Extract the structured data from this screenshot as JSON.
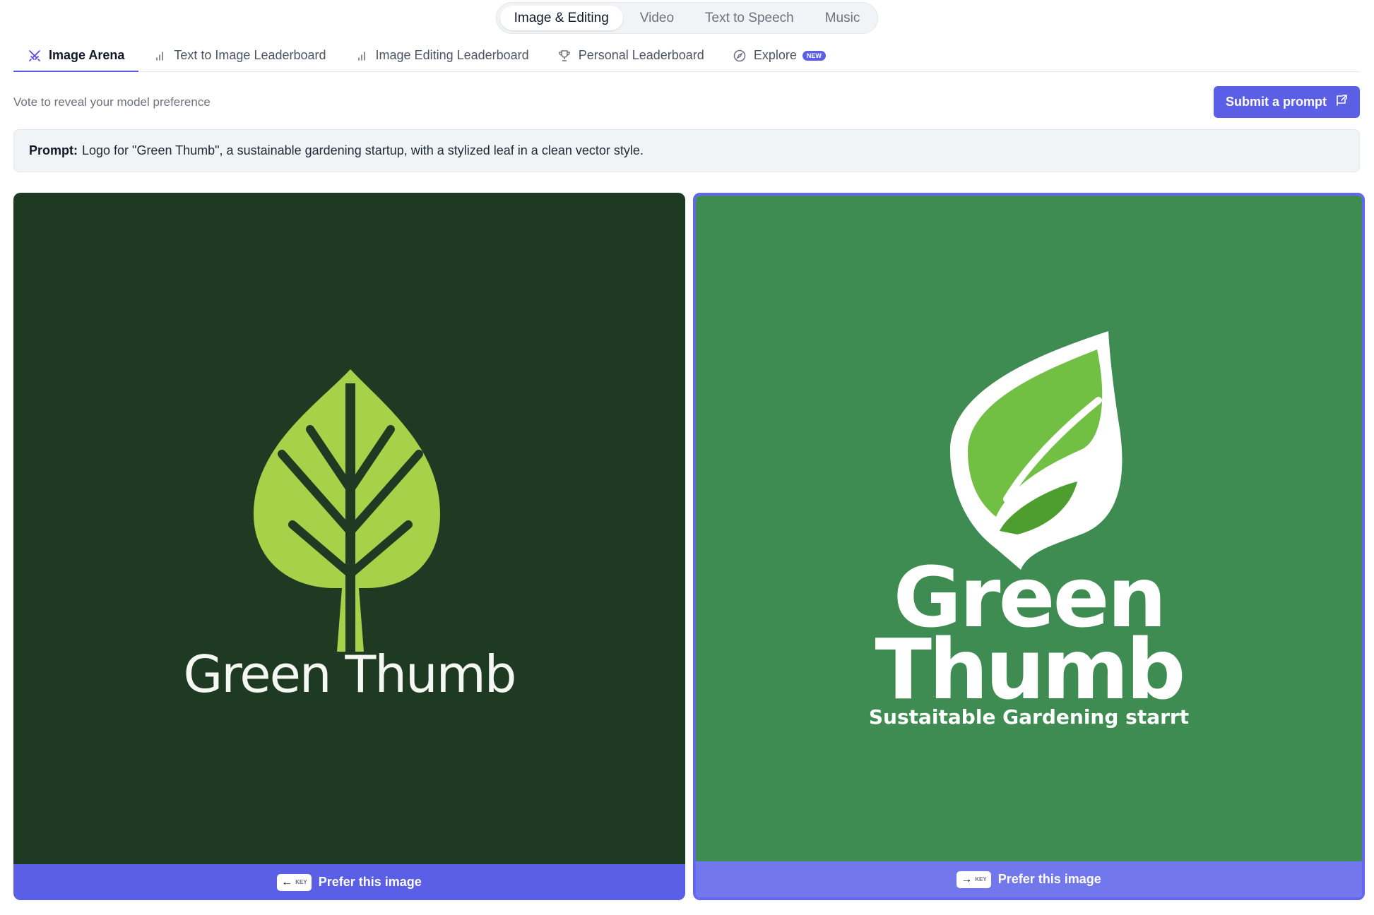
{
  "top_nav": {
    "items": [
      {
        "label": "Image & Editing",
        "active": true
      },
      {
        "label": "Video",
        "active": false
      },
      {
        "label": "Text to Speech",
        "active": false
      },
      {
        "label": "Music",
        "active": false
      }
    ]
  },
  "tabs": [
    {
      "label": "Image Arena",
      "icon": "arena-icon",
      "active": true
    },
    {
      "label": "Text to Image Leaderboard",
      "icon": "bar-chart-icon",
      "active": false
    },
    {
      "label": "Image Editing Leaderboard",
      "icon": "bar-chart-icon",
      "active": false
    },
    {
      "label": "Personal Leaderboard",
      "icon": "trophy-icon",
      "active": false
    },
    {
      "label": "Explore",
      "icon": "compass-icon",
      "active": false,
      "badge": "NEW"
    }
  ],
  "subtitle": "Vote to reveal your model preference",
  "submit_button": {
    "label": "Submit a prompt",
    "icon": "external-share-icon"
  },
  "prompt": {
    "label": "Prompt:",
    "text": "Logo for \"Green Thumb\", a sustainable gardening startup, with a stylized leaf in a clean vector style."
  },
  "cards": {
    "left": {
      "image_text": "Green Thumb",
      "prefer_label": "Prefer this image",
      "key_label": "KEY",
      "key_icon": "arrow-left-icon"
    },
    "right": {
      "image_text_line1": "Green",
      "image_text_line2": "Thumb",
      "image_tagline": "Sustaitable Gardening starrt",
      "prefer_label": "Prefer this image",
      "key_label": "KEY",
      "key_icon": "arrow-right-icon"
    }
  },
  "colors": {
    "accent": "#5b5fe6",
    "left_bg": "#1f3a22",
    "right_bg": "#3e8c51",
    "left_leaf": "#a8d14a",
    "right_leaf": "#6cbf3a"
  }
}
